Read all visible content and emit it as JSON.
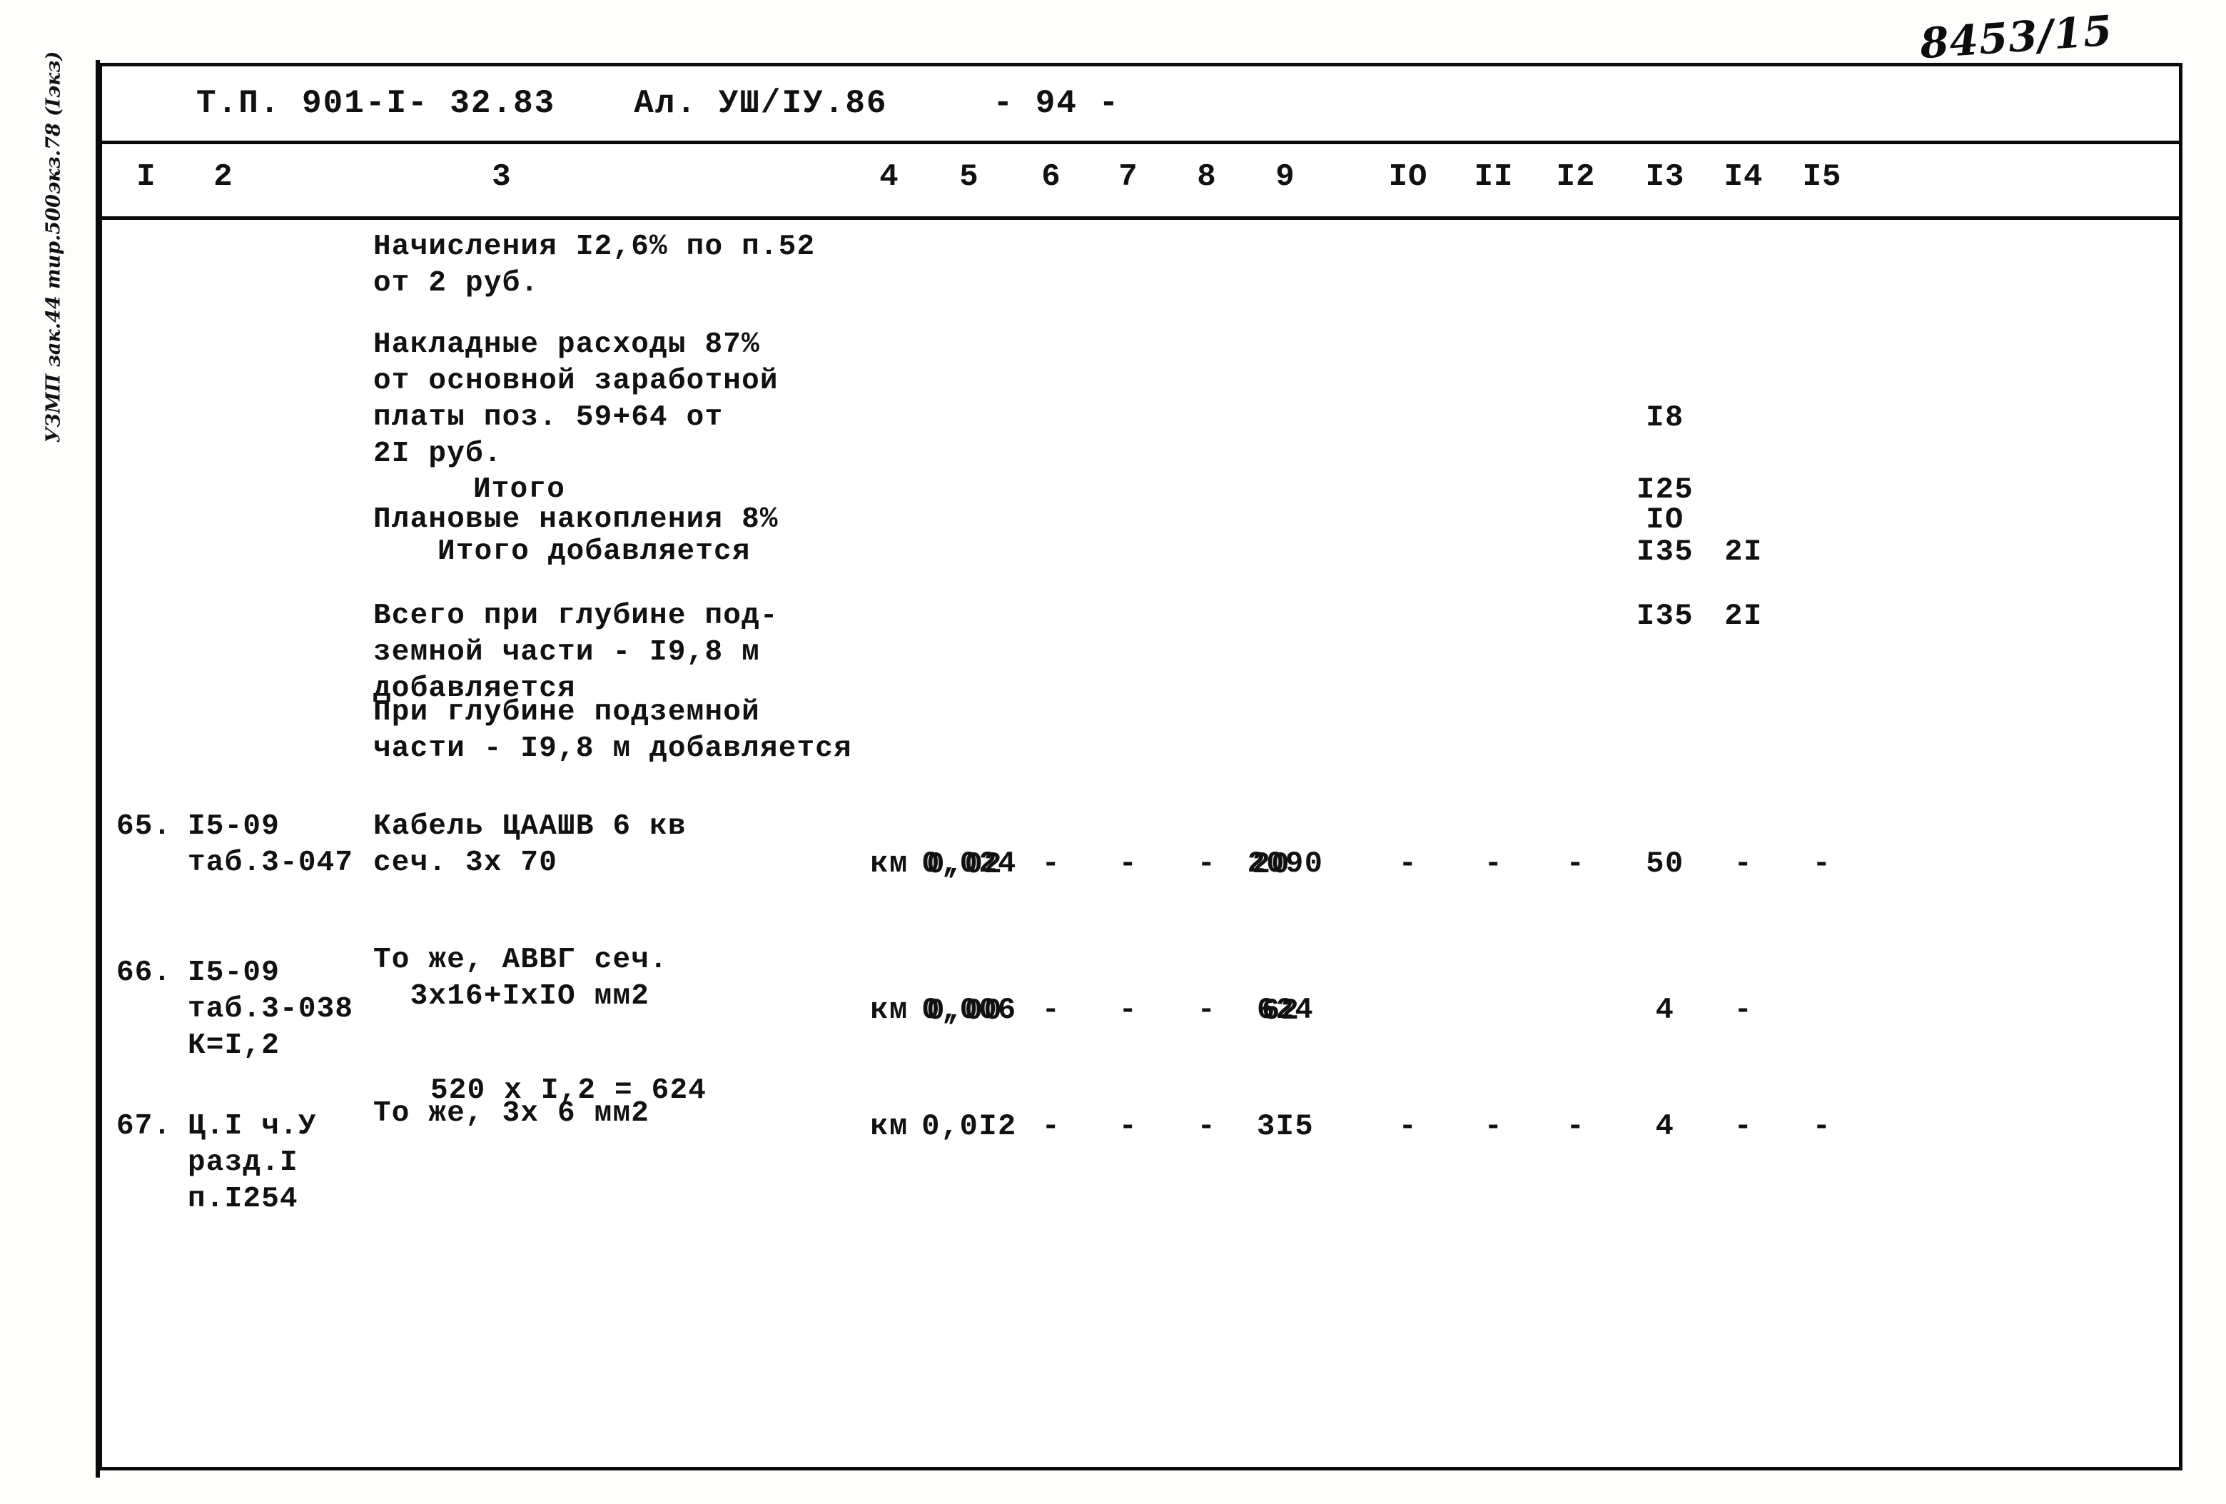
{
  "archive_number": "8453/15",
  "imprint": "УЗМП зак.44 тир.500экз.78 (Iэкз)",
  "header": {
    "doc_code": "Т.П. 901-I- 32.83",
    "album_code": "Ал. УШ/IУ.86",
    "page_number": "- 94 -"
  },
  "column_numbers": [
    "I",
    "2",
    "3",
    "4",
    "5",
    "6",
    "7",
    "8",
    "9",
    "IO",
    "II",
    "I2",
    "I3",
    "I4",
    "I5"
  ],
  "blocks": [
    {
      "id": "b1",
      "text": "Начисления I2,6% по п.52\nот 2 руб.",
      "col13": "",
      "col14": ""
    },
    {
      "id": "b2",
      "text": "Накладные расходы 87%\nот основной заработной\nплаты поз. 59+64 от\n2I руб.",
      "col13": "I8",
      "col14": ""
    },
    {
      "id": "b3",
      "text": "Итого",
      "col13": "I25",
      "col14": ""
    },
    {
      "id": "b4",
      "text": "Плановые накопления 8%",
      "col13": "IO",
      "col14": ""
    },
    {
      "id": "b5",
      "text": "Итого добавляется",
      "col13": "I35",
      "col14": "2I"
    },
    {
      "id": "b6",
      "text": "Всего при глубине под-\nземной части - I9,8 м\nдобавляется",
      "col13": "I35",
      "col14": "2I"
    },
    {
      "id": "b7",
      "text": "При глубине подземной\nчасти - I9,8 м добавляется",
      "col13": "",
      "col14": ""
    }
  ],
  "rows": [
    {
      "pos": "65.",
      "justification": "I5-09\nтаб.3-047",
      "description": "Кабель ЦААШВ 6 кв\nсеч. 3х 70",
      "unit": "км",
      "qty": "0,024",
      "qty_overstrike": "0,02",
      "c6": "-",
      "c7": "-",
      "c8": "-",
      "c9": "2090",
      "c9_overstrike": "20",
      "c10": "-",
      "c11": "-",
      "c12": "-",
      "c13": "50",
      "c14": "-",
      "c15": "-"
    },
    {
      "pos": "66.",
      "justification": "I5-09\nтаб.3-038\nК=I,2",
      "description": "То же, АВВГ сеч.\n  3х16+IхIO мм2",
      "calc": "520 x I,2 = 624",
      "unit": "км",
      "qty": "0,006",
      "qty_overstrike": "0,00",
      "c6": "-",
      "c7": "-",
      "c8": "-",
      "c9": "624",
      "c9_overstrike": "62",
      "c10": "",
      "c11": "",
      "c12": "",
      "c13": "4",
      "c14": "-",
      "c15": ""
    },
    {
      "pos": "67.",
      "justification": "Ц.I ч.У\nразд.I\nп.I254",
      "description": "То же, 3х 6 мм2",
      "unit": "км",
      "qty": "0,0I2",
      "qty_overstrike": "",
      "c6": "-",
      "c7": "-",
      "c8": "-",
      "c9": "3I5",
      "c9_overstrike": "",
      "c10": "-",
      "c11": "-",
      "c12": "-",
      "c13": "4",
      "c14": "-",
      "c15": "-"
    }
  ]
}
